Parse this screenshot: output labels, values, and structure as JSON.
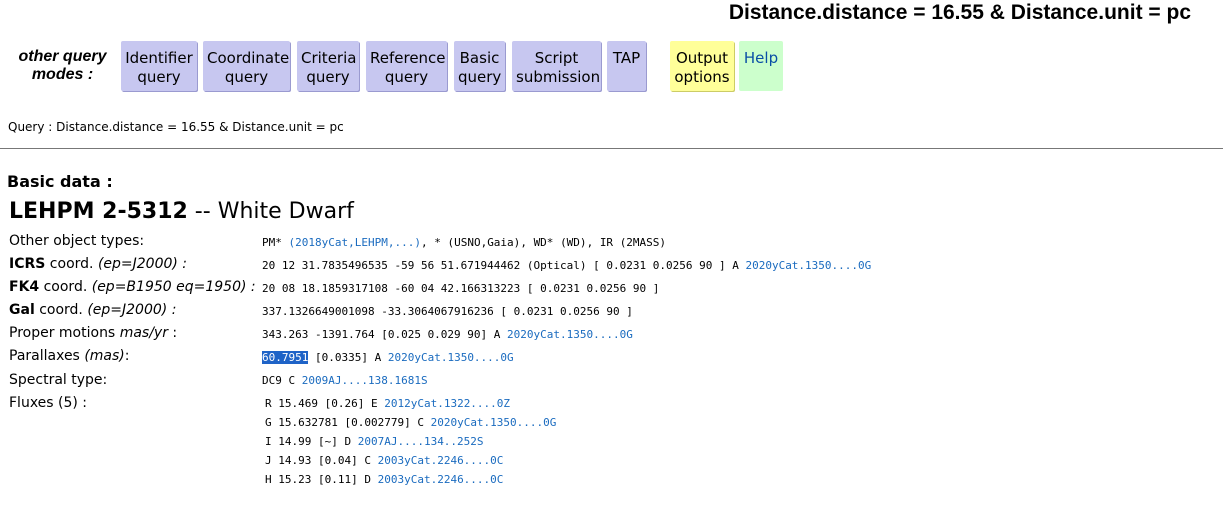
{
  "header": {
    "title": "Distance.distance = 16.55 & Distance.unit = pc"
  },
  "modes": {
    "label_line1": "other query",
    "label_line2": "modes :",
    "buttons": [
      {
        "line1": "Identifier",
        "line2": "query"
      },
      {
        "line1": "Coordinate",
        "line2": "query"
      },
      {
        "line1": "Criteria",
        "line2": "query"
      },
      {
        "line1": "Reference",
        "line2": "query"
      },
      {
        "line1": "Basic",
        "line2": "query"
      },
      {
        "line1": "Script",
        "line2": "submission"
      },
      {
        "line1": "TAP",
        "line2": ""
      },
      {
        "line1": "Output",
        "line2": "options"
      },
      {
        "line1": "Help",
        "line2": ""
      }
    ]
  },
  "query": {
    "text": "Query : Distance.distance = 16.55 & Distance.unit = pc"
  },
  "basic": {
    "section_title": "Basic data :",
    "name": "LEHPM 2-5312",
    "sep": " -- ",
    "otype": "White Dwarf"
  },
  "fields": {
    "other_types_label": "Other object types:",
    "other_types": {
      "t1": "PM*",
      "t1_ref": "(2018yCat,LEHPM,...)",
      "sep1": ", ",
      "t2": "*",
      "t2_ref": "(USNO,Gaia)",
      "sep2": ", ",
      "t3": "WD*",
      "t3_ref": "(WD)",
      "sep3": ", ",
      "t4": "IR",
      "t4_ref": "(2MASS)"
    },
    "icrs_label_bold": "ICRS",
    "icrs_label_rest": " coord. ",
    "icrs_label_it": "(ep=J2000) :",
    "icrs_value": "20 12 31.7835496535 -59 56 51.671944462 (Optical) [ 0.0231 0.0256 90 ] A ",
    "icrs_ref": "2020yCat.1350....0G",
    "fk4_label_bold": "FK4",
    "fk4_label_rest": " coord. ",
    "fk4_label_it": "(ep=B1950 eq=1950) :",
    "fk4_value": "20 08 18.1859317108 -60 04 42.166313223 [ 0.0231 0.0256 90 ]",
    "gal_label_bold": "Gal",
    "gal_label_rest": " coord. ",
    "gal_label_it": "(ep=J2000) :",
    "gal_value": "337.1326649001098 -33.3064067916236 [ 0.0231 0.0256 90 ]",
    "pm_label": "Proper motions ",
    "pm_label_it": "mas/yr",
    "pm_label_end": " :",
    "pm_value": "343.263 -1391.764 [0.025 0.029 90] A ",
    "pm_ref": "2020yCat.1350....0G",
    "plx_label": "Parallaxes ",
    "plx_label_it": "(mas)",
    "plx_label_end": ":",
    "plx_value_hl": "60.7951",
    "plx_value": " [0.0335] A ",
    "plx_ref": "2020yCat.1350....0G",
    "sp_label": "Spectral type:",
    "sp_value": "DC9 C ",
    "sp_ref": "2009AJ....138.1681S",
    "flux_label": "Fluxes (5) :",
    "fluxes": [
      {
        "text": "R 15.469 [0.26] E ",
        "ref": "2012yCat.1322....0Z"
      },
      {
        "text": "G 15.632781 [0.002779] C ",
        "ref": "2020yCat.1350....0G"
      },
      {
        "text": "I 14.99 [~] D ",
        "ref": "2007AJ....134..252S"
      },
      {
        "text": "J 14.93 [0.04] C ",
        "ref": "2003yCat.2246....0C"
      },
      {
        "text": "H 15.23 [0.11] D ",
        "ref": "2003yCat.2246....0C"
      }
    ]
  }
}
